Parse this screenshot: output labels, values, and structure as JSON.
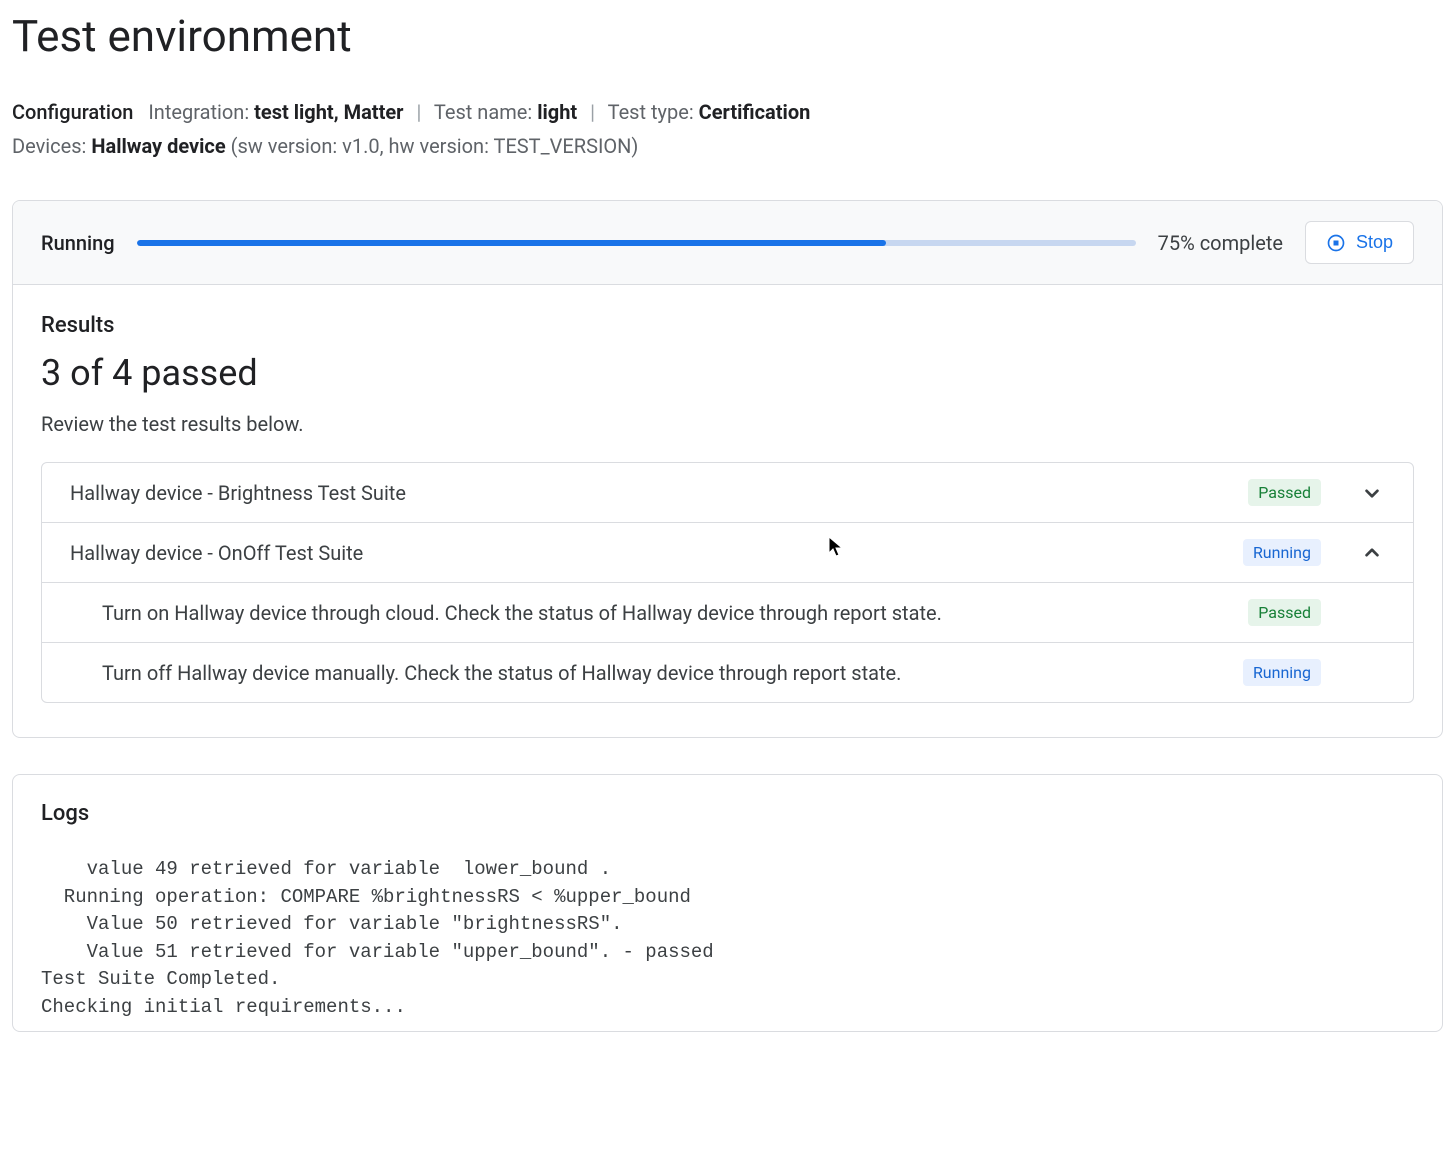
{
  "page_title": "Test environment",
  "config": {
    "configuration_label": "Configuration",
    "integration_label": "Integration:",
    "integration_value": "test light, Matter",
    "test_name_label": "Test name:",
    "test_name_value": "light",
    "test_type_label": "Test type:",
    "test_type_value": "Certification",
    "devices_label": "Devices:",
    "device_name": "Hallway device",
    "device_meta": "(sw version: v1.0, hw version: TEST_VERSION)"
  },
  "progress": {
    "status_label": "Running",
    "percent": 75,
    "percent_text": "75% complete",
    "stop_label": "Stop"
  },
  "results": {
    "heading": "Results",
    "count_text": "3 of 4 passed",
    "subtext": "Review the test results below.",
    "suites": [
      {
        "title": "Hallway device - Brightness Test Suite",
        "status": "Passed",
        "expanded": false,
        "tests": []
      },
      {
        "title": "Hallway device - OnOff Test Suite",
        "status": "Running",
        "expanded": true,
        "tests": [
          {
            "title": "Turn on Hallway device through cloud. Check the status of Hallway device through report state.",
            "status": "Passed"
          },
          {
            "title": "Turn off Hallway device manually. Check the status of Hallway device through report state.",
            "status": "Running"
          }
        ]
      }
    ]
  },
  "logs": {
    "heading": "Logs",
    "lines": [
      "    value 49 retrieved for variable  lower_bound .",
      "  Running operation: COMPARE %brightnessRS < %upper_bound",
      "    Value 50 retrieved for variable \"brightnessRS\".",
      "    Value 51 retrieved for variable \"upper_bound\". - passed",
      "Test Suite Completed.",
      "Checking initial requirements..."
    ]
  },
  "colors": {
    "accent": "#1a73e8"
  }
}
